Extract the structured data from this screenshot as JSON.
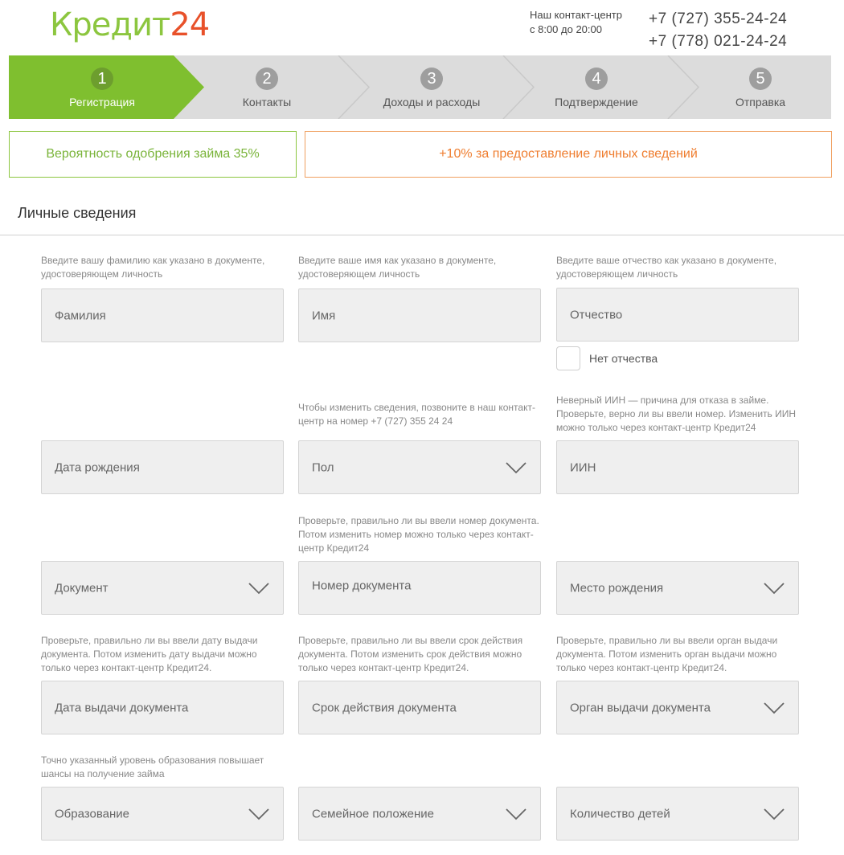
{
  "brand": {
    "name_part1": "Кредит",
    "name_part2": "24"
  },
  "contact": {
    "label_line1": "Наш контакт-центр",
    "label_line2": "с 8:00 до 20:00",
    "phone1": "+7 (727) 355-24-24",
    "phone2": "+7 (778) 021-24-24"
  },
  "steps": [
    {
      "num": "1",
      "label": "Регистрация",
      "active": true
    },
    {
      "num": "2",
      "label": "Контакты",
      "active": false
    },
    {
      "num": "3",
      "label": "Доходы и расходы",
      "active": false
    },
    {
      "num": "4",
      "label": "Подтверждение",
      "active": false
    },
    {
      "num": "5",
      "label": "Отправка",
      "active": false
    }
  ],
  "banners": {
    "approval": "Вероятность одобрения займа 35%",
    "bonus": "+10% за предоставление личных сведений"
  },
  "section_title": "Личные сведения",
  "hints": {
    "surname": "Введите вашу фамилию как указано в документе, удостоверяющем личность",
    "name": "Введите ваше имя как указано в документе, удостоверяющем личность",
    "patronymic": "Введите ваше отчество как указано в документе, удостоверяющем личность",
    "gender": "Чтобы изменить сведения, позвоните в наш контакт-центр на номер +7 (727) 355 24 24",
    "iin": "Неверный ИИН — причина для отказа в займе. Проверьте, верно ли вы ввели номер. Изменить ИИН можно только через контакт-центр Кредит24",
    "doc_number": "Проверьте, правильно ли вы ввели номер документа. Потом изменить номер можно только через контакт-центр Кредит24",
    "issue_date": "Проверьте, правильно ли вы ввели дату выдачи документа. Потом изменить дату выдачи можно только через контакт-центр Кредит24.",
    "expiry": "Проверьте, правильно ли вы ввели срок действия документа. Потом изменить срок действия можно только через контакт-центр Кредит24.",
    "authority": "Проверьте, правильно ли вы ввели орган выдачи документа. Потом изменить орган выдачи можно только через контакт-центр Кредит24.",
    "education": "Точно указанный уровень образования повышает шансы на получение займа"
  },
  "fields": {
    "surname": "Фамилия",
    "name": "Имя",
    "patronymic": "Отчество",
    "no_patronymic": "Нет отчества",
    "birth_date": "Дата рождения",
    "gender": "Пол",
    "iin": "ИИН",
    "document": "Документ",
    "doc_number": "Номер документа",
    "birth_place": "Место рождения",
    "issue_date": "Дата выдачи документа",
    "expiry": "Срок действия документа",
    "authority": "Орган выдачи документа",
    "education": "Образование",
    "marital": "Семейное положение",
    "children": "Количество детей"
  },
  "colors": {
    "brand_green": "#8cc63f",
    "brand_orange": "#e8512a",
    "step_bg": "#dcdcdc"
  }
}
